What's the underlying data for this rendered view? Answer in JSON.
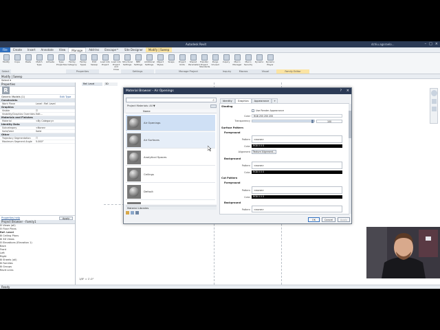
{
  "titlebar": {
    "app_title": "Autodesk Revit",
    "user": "dchiu.agoraelo..."
  },
  "ribbon_tabs": [
    "File",
    "Create",
    "Insert",
    "Annotate",
    "View",
    "Manage",
    "Add-Ins",
    "Enscape™",
    "Site Designer",
    "Modify | Sweep"
  ],
  "ribbon": {
    "buttons": [
      "Modify",
      "Cope",
      "Paste",
      "Match Type",
      "Activate",
      "Type Properties",
      "Family Category",
      "Family Types",
      "Edit Sweep",
      "Load into Project",
      "Load into Project and Close",
      "Structural Settings",
      "MEP Settings",
      "Additional Settings",
      "Object Styles",
      "Snaps",
      "Project Units",
      "Shared Parameters",
      "Transfer Project Standards",
      "Purge Unused",
      "Inquiry",
      "Macro Manager",
      "Macro Security",
      "Dynamo",
      "Dynamo Player"
    ],
    "panels": [
      "Select",
      "Properties",
      "Settings",
      "Manage Project",
      "Inquiry",
      "Macros",
      "Visual Programming",
      "Family Editor"
    ]
  },
  "contextbar": "Modify | Sweep",
  "select_label": "Select ▾",
  "properties": {
    "title": "Properties",
    "type": "Generic Models (1)",
    "edit_type": "Edit Type",
    "sections": [
      {
        "name": "Constraints",
        "rows": [
          [
            "Work Plane",
            "Level : Ref. Level"
          ]
        ]
      },
      {
        "name": "Graphics",
        "rows": [
          [
            "Visible",
            "☑"
          ],
          [
            "Visibility/Graphics Overrides",
            "Edit..."
          ]
        ]
      },
      {
        "name": "Materials and Finishes",
        "rows": [
          [
            "Material",
            "<By Category>"
          ]
        ]
      },
      {
        "name": "Identity Data",
        "rows": [
          [
            "Subcategory",
            "<None>"
          ],
          [
            "Solid/Void",
            "Solid"
          ]
        ]
      },
      {
        "name": "Other",
        "rows": [
          [
            "Trajectory Segmentation",
            "☐"
          ],
          [
            "Maximum Segment Angle",
            "5.000°"
          ]
        ]
      }
    ],
    "help_link": "Properties help",
    "apply": "Apply"
  },
  "browser": {
    "title": "Project Browser - Family1",
    "items": [
      "⊟ Views (all)",
      "   ⊟ Floor Plans",
      "        Ref. Level",
      "   ⊞ Ceiling Plans",
      "   ⊞ 3D Views",
      "   ⊟ Elevations (Elevation 1)",
      "        Back",
      "        Front",
      "        Left",
      "        Right",
      "⊞ Sheets (all)",
      "⊞ Families",
      "⊞ Groups",
      "  Revit Links"
    ]
  },
  "status": {
    "text": "Ready",
    "scale": "1/8\" = 1'-0\""
  },
  "dialog": {
    "title": "Material Browser - Air Openings",
    "search_placeholder": "",
    "filter": "Project Materials: All ▼",
    "list_header": "Name",
    "materials": [
      "Air Openings",
      "Air Surfaces",
      "Analytical Spaces",
      "Ceilings",
      "Default"
    ],
    "library_label": "Material Libraries",
    "tabs": [
      "Identity",
      "Graphics",
      "Appearance",
      "+"
    ],
    "shading": {
      "header": "Shading",
      "use_render": "Use Render Appearance",
      "color_label": "Color",
      "color_value": "RGB 255 255 255",
      "transparency_label": "Transparency",
      "transparency_value": "100"
    },
    "surface_pattern": {
      "header": "Surface Pattern",
      "foreground": "Foreground",
      "fg_pattern_label": "Pattern",
      "fg_pattern": "<none>",
      "fg_color_label": "Color",
      "fg_color": "RGB 0 0 0",
      "alignment_label": "Alignment",
      "alignment_btn": "Texture Alignment...",
      "background": "Background",
      "bg_pattern_label": "Pattern",
      "bg_pattern": "<none>",
      "bg_color_label": "Color",
      "bg_color": "RGB 0 0 0"
    },
    "cut_pattern": {
      "header": "Cut Pattern",
      "foreground": "Foreground",
      "fg_pattern_label": "Pattern",
      "fg_pattern": "<none>",
      "fg_color_label": "Color",
      "fg_color": "RGB 0 0 0",
      "background": "Background",
      "bg_pattern_label": "Pattern",
      "bg_pattern": "<none>"
    },
    "buttons": {
      "ok": "OK",
      "cancel": "Cancel",
      "apply": "Apply"
    }
  }
}
